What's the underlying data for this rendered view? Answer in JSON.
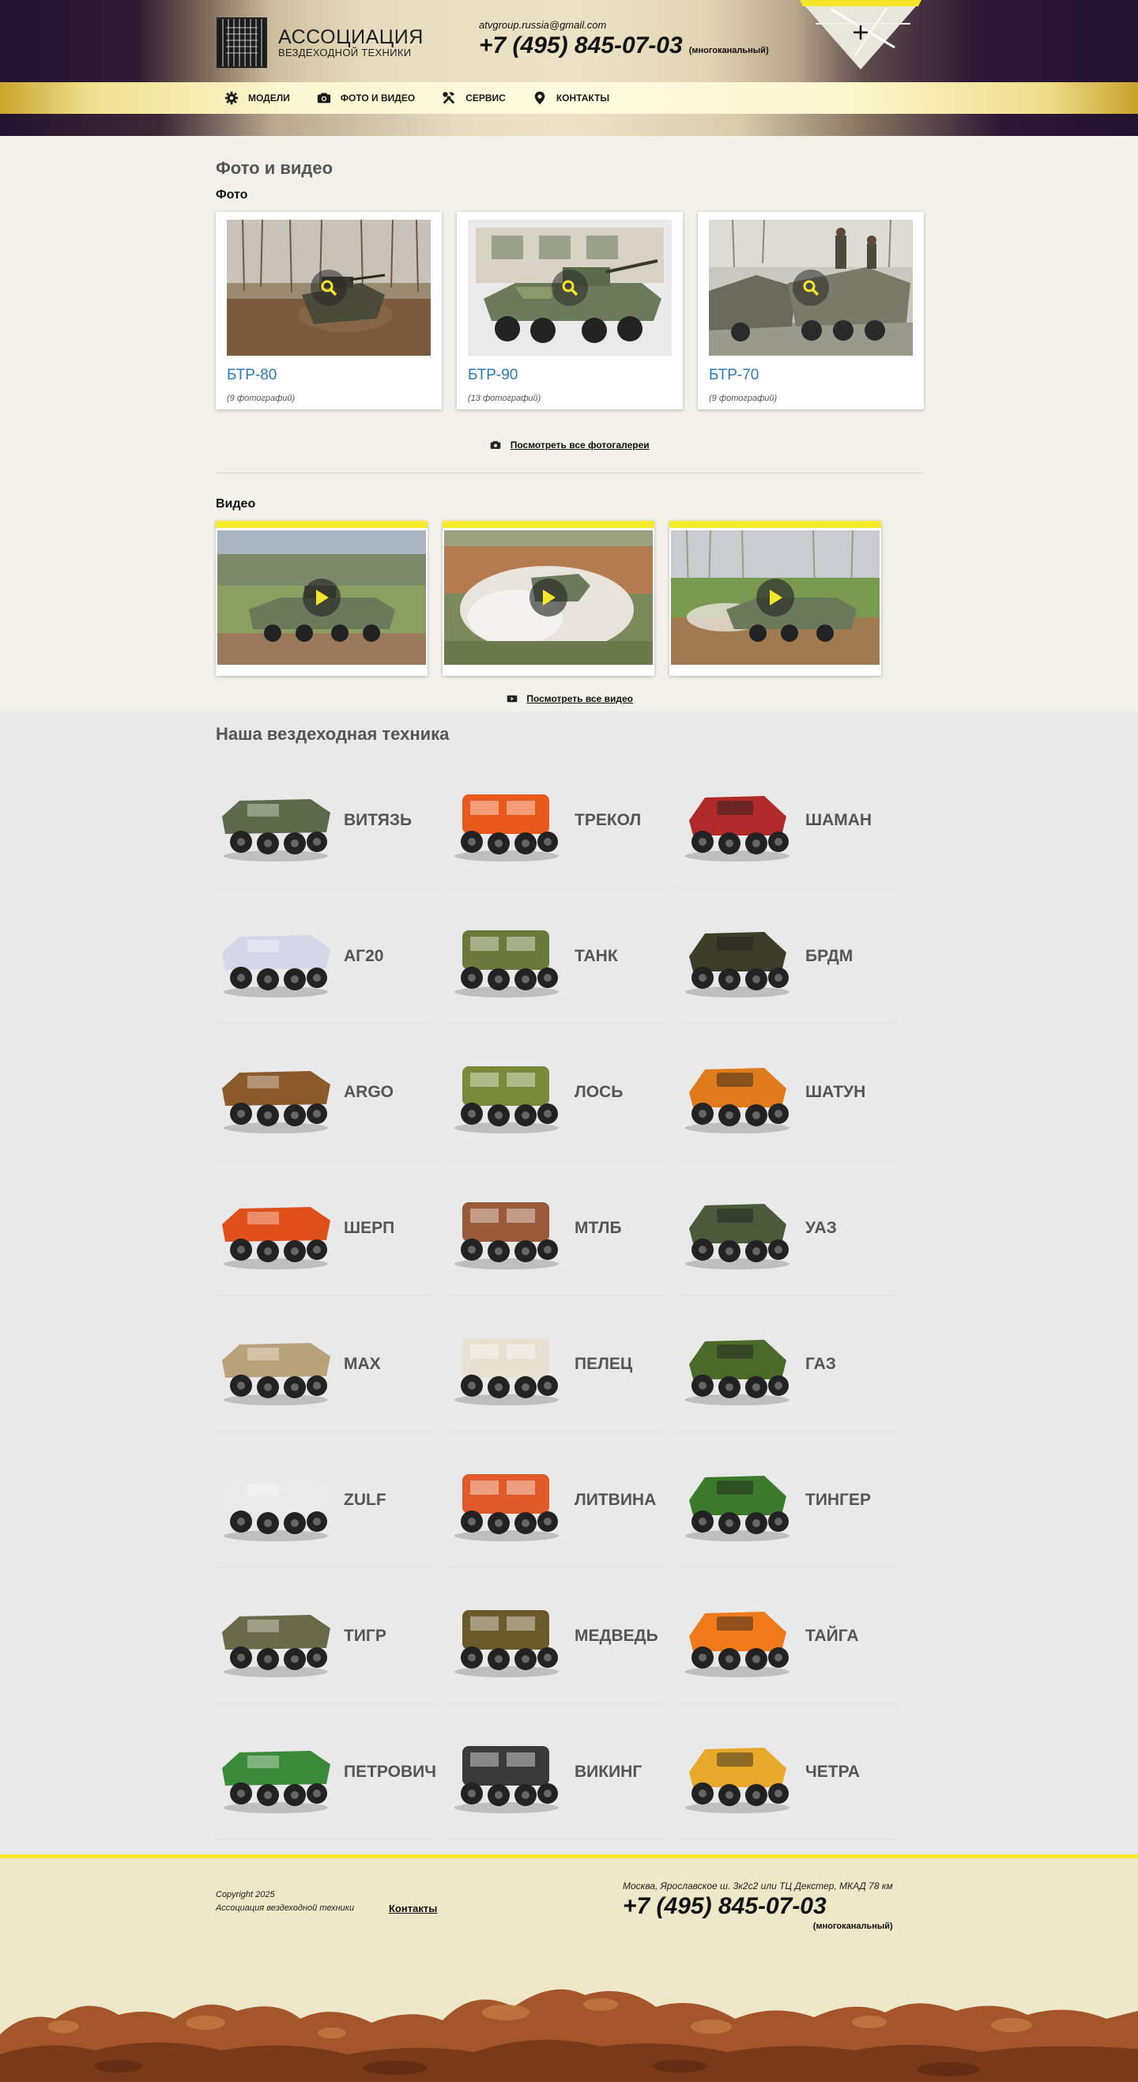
{
  "header": {
    "logo_title": "АССОЦИАЦИЯ",
    "logo_subtitle": "ВЕЗДЕХОДНОЙ ТЕХНИКИ",
    "email": "atvgroup.russia@gmail.com",
    "phone": "+7 (495) 845-07-03",
    "phone_note": "(многоканальный)"
  },
  "nav": {
    "items": [
      {
        "label": "Модели",
        "icon": "gear-icon"
      },
      {
        "label": "Фото и видео",
        "icon": "camera-icon"
      },
      {
        "label": "Сервис",
        "icon": "tools-icon"
      },
      {
        "label": "Контакты",
        "icon": "map-pin-icon"
      }
    ]
  },
  "media": {
    "title": "Фото и видео",
    "photo_heading": "Фото",
    "photos": [
      {
        "title": "БТР-80",
        "count": "(9 фотографий)"
      },
      {
        "title": "БТР-90",
        "count": "(13 фотографий)"
      },
      {
        "title": "БТР-70",
        "count": "(9 фотографий)"
      }
    ],
    "all_photos_link": "Посмотреть все фотогалереи",
    "video_heading": "Видео",
    "all_videos_link": "Посмотреть все видео"
  },
  "vehicles": {
    "title": "Наша вездеходная техника",
    "items": [
      {
        "name": "ВИТЯЗЬ",
        "color": "#5a6a4a"
      },
      {
        "name": "ТРЕКОЛ",
        "color": "#e85a1c"
      },
      {
        "name": "ШАМАН",
        "color": "#b02a2a"
      },
      {
        "name": "АГ20",
        "color": "#d6d6e8"
      },
      {
        "name": "ТАНК",
        "color": "#6b7a3a"
      },
      {
        "name": "БРДМ",
        "color": "#3d3d2a"
      },
      {
        "name": "ARGO",
        "color": "#8a5a2a"
      },
      {
        "name": "ЛОСЬ",
        "color": "#7a8a3a"
      },
      {
        "name": "ШАТУН",
        "color": "#e07a1a"
      },
      {
        "name": "ШЕРП",
        "color": "#e0501a"
      },
      {
        "name": "МТЛБ",
        "color": "#9a5a3a"
      },
      {
        "name": "УАЗ",
        "color": "#4a5a3a"
      },
      {
        "name": "MAX",
        "color": "#b8a27a"
      },
      {
        "name": "ПЕЛЕЦ",
        "color": "#e8e0d0"
      },
      {
        "name": "ГАЗ",
        "color": "#4a6a2a"
      },
      {
        "name": "ZULF",
        "color": "#eaeaea"
      },
      {
        "name": "ЛИТВИНА",
        "color": "#e05a2a"
      },
      {
        "name": "ТИНГЕР",
        "color": "#3a7a2a"
      },
      {
        "name": "ТИГР",
        "color": "#6a6a4a"
      },
      {
        "name": "МЕДВЕДЬ",
        "color": "#6a5a2a"
      },
      {
        "name": "ТАЙГА",
        "color": "#f07a1a"
      },
      {
        "name": "ПЕТРОВИЧ",
        "color": "#3a8a3a"
      },
      {
        "name": "ВИКИНГ",
        "color": "#3a3a3a"
      },
      {
        "name": "ЧЕТРА",
        "color": "#e8a82a"
      }
    ]
  },
  "footer": {
    "copyright_line1": "Copyright 2025",
    "copyright_line2": "Ассоциация вездеходной техники",
    "contacts_link": "Контакты",
    "address": "Москва, Ярославское ш. 3к2с2 или ТЦ Декстер, МКАД 78 км",
    "phone": "+7 (495) 845-07-03",
    "phone_note": "(многоканальный)"
  }
}
